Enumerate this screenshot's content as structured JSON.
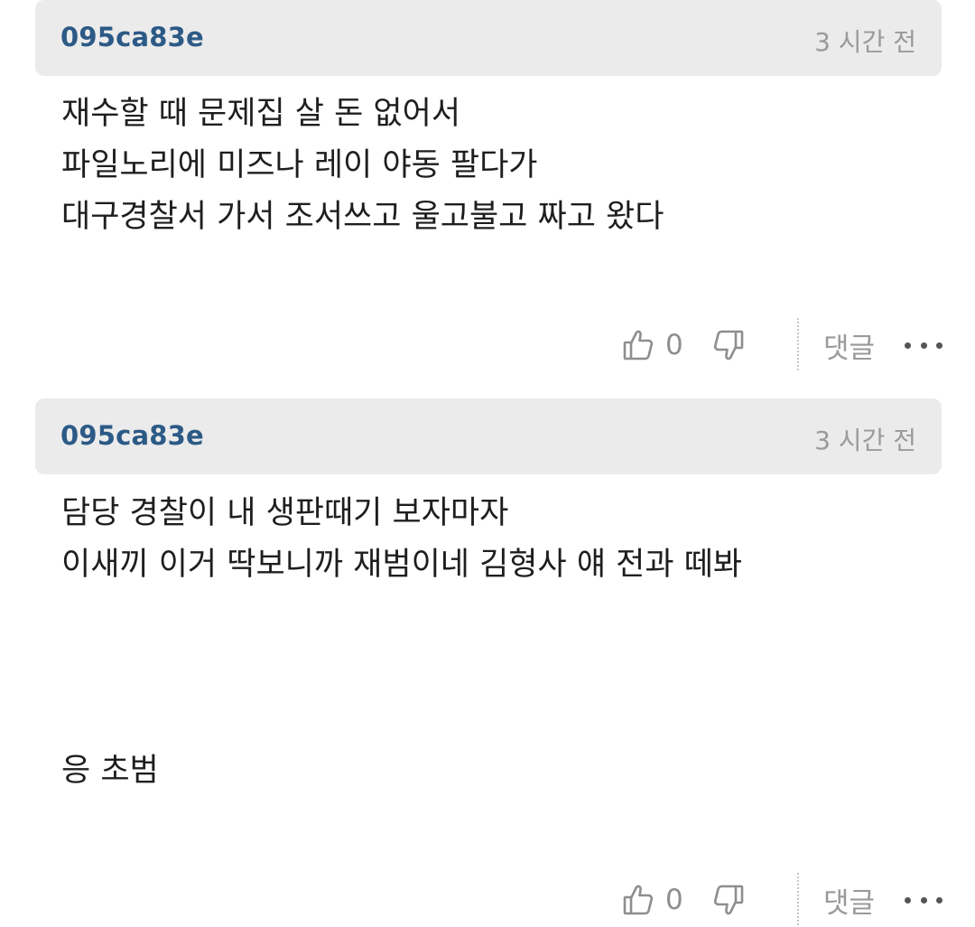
{
  "comments": [
    {
      "author": "095ca83e",
      "time": "3 시간 전",
      "lines": [
        "재수할 때 문제집 살 돈 없어서",
        "파일노리에 미즈나 레이 야동 팔다가",
        "대구경찰서 가서 조서쓰고 울고불고 짜고 왔다"
      ],
      "likes": "0",
      "reply_label": "댓글"
    },
    {
      "author": "095ca83e",
      "time": "3 시간 전",
      "lines": [
        "담당 경찰이 내 생판때기 보자마자",
        "이새끼 이거 딱보니까 재범이네 김형사 얘 전과 떼봐",
        "",
        "",
        "",
        "응 초범"
      ],
      "likes": "0",
      "reply_label": "댓글"
    }
  ],
  "icons": {
    "like": "thumbs-up-icon",
    "dislike": "thumbs-down-icon",
    "more": "more-horizontal-icon"
  },
  "colors": {
    "author": "#2c5a86",
    "header_bg": "#ebebeb",
    "muted": "#9a9a9a"
  }
}
